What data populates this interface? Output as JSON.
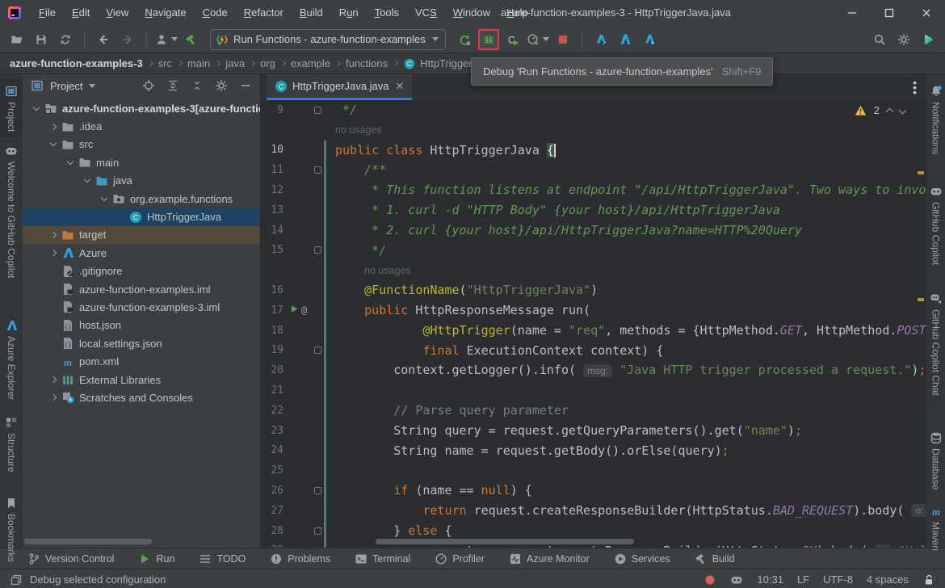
{
  "app": {
    "title": "azure-function-examples-3 - HttpTriggerJava.java"
  },
  "menu_bar": {
    "items": [
      {
        "label": "File",
        "m": 0
      },
      {
        "label": "Edit",
        "m": 0
      },
      {
        "label": "View",
        "m": 0
      },
      {
        "label": "Navigate",
        "m": 0
      },
      {
        "label": "Code",
        "m": 0
      },
      {
        "label": "Refactor",
        "m": 0
      },
      {
        "label": "Build",
        "m": 0
      },
      {
        "label": "Run",
        "m": 1
      },
      {
        "label": "Tools",
        "m": 0
      },
      {
        "label": "VCS",
        "m": 2
      },
      {
        "label": "Window",
        "m": 0
      },
      {
        "label": "Help",
        "m": 0
      }
    ]
  },
  "toolbar": {
    "run_config": {
      "label": "Run Functions - azure-function-examples",
      "icon": "azure-fn"
    },
    "buttons_left": [
      "open",
      "save",
      "sync",
      "back",
      "forward",
      "user",
      "hammer"
    ],
    "buttons_run": [
      "rerun",
      "debug",
      "coverage",
      "profiler",
      "stop"
    ],
    "buttons_azure": [
      "azure-action-1",
      "azure-action-2",
      "azure-action-3"
    ],
    "buttons_right": [
      "search",
      "settings",
      "plugin"
    ],
    "debug_highlighted": true
  },
  "tooltip": {
    "text": "Debug 'Run Functions - azure-function-examples'",
    "shortcut": "Shift+F9"
  },
  "breadcrumbs": {
    "items": [
      "azure-function-examples-3",
      "src",
      "main",
      "java",
      "org",
      "example",
      "functions",
      "HttpTriggerJava"
    ]
  },
  "left_stripe": {
    "items": [
      {
        "label": "Project",
        "icon": "project-tool",
        "active": true
      },
      {
        "label": "Welcome to GitHub Copilot",
        "icon": "copilot"
      },
      {
        "label": "Azure Explorer",
        "icon": "azure"
      },
      {
        "label": "Structure",
        "icon": "structure"
      },
      {
        "label": "Bookmarks",
        "icon": "bookmarks"
      }
    ]
  },
  "right_stripe": {
    "items": [
      {
        "label": "Notifications",
        "icon": "bell"
      },
      {
        "label": "GitHub Copilot",
        "icon": "copilot"
      },
      {
        "label": "GitHub Copilot Chat",
        "icon": "copilot-chat"
      },
      {
        "label": "Database",
        "icon": "database"
      },
      {
        "label": "Maven",
        "icon": "maven"
      }
    ]
  },
  "project_panel": {
    "title": "Project",
    "header_buttons": [
      "locate",
      "expand-all",
      "collapse-all",
      "options",
      "hide"
    ],
    "tree": [
      {
        "label": "azure-function-examples-3",
        "suffix": " [azure-functio",
        "level": 0,
        "chev": "open",
        "icon": "folder-root",
        "bold": true
      },
      {
        "label": ".idea",
        "level": 1,
        "chev": "closed",
        "icon": "folder"
      },
      {
        "label": "src",
        "level": 1,
        "chev": "open",
        "icon": "folder"
      },
      {
        "label": "main",
        "level": 2,
        "chev": "open",
        "icon": "folder"
      },
      {
        "label": "java",
        "level": 3,
        "chev": "open",
        "icon": "folder-src"
      },
      {
        "label": "org.example.functions",
        "level": 4,
        "chev": "open",
        "icon": "package"
      },
      {
        "label": "HttpTriggerJava",
        "level": 5,
        "chev": "none",
        "icon": "class",
        "selected": true
      },
      {
        "label": "target",
        "level": 1,
        "chev": "closed",
        "icon": "folder-excluded",
        "highlight": true
      },
      {
        "label": "Azure",
        "level": 1,
        "chev": "closed",
        "icon": "azure"
      },
      {
        "label": ".gitignore",
        "level": 1,
        "chev": "none",
        "icon": "file-ignore"
      },
      {
        "label": "azure-function-examples.iml",
        "level": 1,
        "chev": "none",
        "icon": "file-iml"
      },
      {
        "label": "azure-function-examples-3.iml",
        "level": 1,
        "chev": "none",
        "icon": "file-iml"
      },
      {
        "label": "host.json",
        "level": 1,
        "chev": "none",
        "icon": "file-json"
      },
      {
        "label": "local.settings.json",
        "level": 1,
        "chev": "none",
        "icon": "file-json"
      },
      {
        "label": "pom.xml",
        "level": 1,
        "chev": "none",
        "icon": "maven"
      },
      {
        "label": "External Libraries",
        "level": 1,
        "chev": "closed",
        "icon": "libraries"
      },
      {
        "label": "Scratches and Consoles",
        "level": 1,
        "chev": "closed",
        "icon": "scratches"
      }
    ]
  },
  "editor": {
    "tab": {
      "label": "HttpTriggerJava.java",
      "icon": "class"
    },
    "inspections": {
      "warning_count": "2"
    },
    "lines": [
      {
        "n": "9",
        "fold": true,
        "seg": [
          [
            " */",
            "doc"
          ]
        ]
      },
      {
        "usages": "no usages",
        "indent": 0
      },
      {
        "n": "10",
        "vcs": true,
        "cursor": true,
        "seg": [
          [
            "public ",
            "k"
          ],
          [
            "class ",
            "k"
          ],
          [
            "HttpTriggerJava ",
            "t"
          ],
          [
            "{",
            "brhl"
          ]
        ]
      },
      {
        "n": "11",
        "vcs": true,
        "fold": true,
        "seg": [
          [
            "    /**",
            "doc"
          ]
        ]
      },
      {
        "n": "12",
        "vcs": true,
        "seg": [
          [
            "     * This function listens at endpoint \"/api/HttpTriggerJava\". Two ways to invoke it using \"curl\" command in bash:",
            "doc"
          ]
        ]
      },
      {
        "n": "13",
        "vcs": true,
        "seg": [
          [
            "     * 1. curl -d \"HTTP Body\" {your host}/api/HttpTriggerJava",
            "doc"
          ]
        ]
      },
      {
        "n": "14",
        "vcs": true,
        "seg": [
          [
            "     * 2. curl {your host}/api/HttpTriggerJava?name=HTTP%20Query",
            "doc"
          ]
        ]
      },
      {
        "n": "15",
        "vcs": true,
        "fold": true,
        "seg": [
          [
            "     */",
            "doc"
          ]
        ]
      },
      {
        "usages": "no usages",
        "indent": 4,
        "vcs": true
      },
      {
        "n": "16",
        "vcs": true,
        "seg": [
          [
            "    ",
            "t"
          ],
          [
            "@FunctionName",
            "ann"
          ],
          [
            "(",
            "t"
          ],
          [
            "\"HttpTriggerJava\"",
            "s"
          ],
          [
            ")",
            "t"
          ]
        ]
      },
      {
        "n": "17",
        "vcs": true,
        "mark": "run",
        "seg": [
          [
            "    ",
            "t"
          ],
          [
            "public ",
            "k"
          ],
          [
            "HttpResponseMessage run(",
            "t"
          ]
        ]
      },
      {
        "n": "18",
        "vcs": true,
        "seg": [
          [
            "            ",
            "t"
          ],
          [
            "@HttpTrigger",
            "ann"
          ],
          [
            "(name = ",
            "t"
          ],
          [
            "\"req\"",
            "s"
          ],
          [
            ", methods = {HttpMethod.",
            "t"
          ],
          [
            "GET",
            "fld"
          ],
          [
            ", HttpMethod.",
            "t"
          ],
          [
            "POST",
            "fld"
          ]
        ]
      },
      {
        "n": "19",
        "vcs": true,
        "fold": true,
        "seg": [
          [
            "            ",
            "t"
          ],
          [
            "final ",
            "k"
          ],
          [
            "ExecutionContext context) {",
            "t"
          ]
        ]
      },
      {
        "n": "20",
        "vcs": true,
        "seg": [
          [
            "        context.getLogger().info( ",
            "t"
          ],
          [
            "msg:",
            "hint"
          ],
          [
            " ",
            "t"
          ],
          [
            "\"Java HTTP trigger processed a request.\"",
            "s"
          ],
          [
            ")",
            "t"
          ],
          [
            ";",
            "semi"
          ]
        ]
      },
      {
        "n": "21",
        "vcs": true,
        "seg": []
      },
      {
        "n": "22",
        "vcs": true,
        "seg": [
          [
            "        ",
            "t"
          ],
          [
            "// Parse query parameter",
            "com"
          ]
        ]
      },
      {
        "n": "23",
        "vcs": true,
        "seg": [
          [
            "        String query = request.getQueryParameters().get(",
            "t"
          ],
          [
            "\"name\"",
            "s"
          ],
          [
            ")",
            "t"
          ],
          [
            ";",
            "semi"
          ]
        ]
      },
      {
        "n": "24",
        "vcs": true,
        "seg": [
          [
            "        String name = request.getBody().orElse(query)",
            "t"
          ],
          [
            ";",
            "semi"
          ]
        ]
      },
      {
        "n": "25",
        "vcs": true,
        "seg": []
      },
      {
        "n": "26",
        "vcs": true,
        "fold": true,
        "seg": [
          [
            "        ",
            "t"
          ],
          [
            "if ",
            "k"
          ],
          [
            "(name == ",
            "t"
          ],
          [
            "null",
            "k"
          ],
          [
            ") {",
            "t"
          ]
        ]
      },
      {
        "n": "27",
        "vcs": true,
        "seg": [
          [
            "            ",
            "t"
          ],
          [
            "return ",
            "k"
          ],
          [
            "request.createResponseBuilder(HttpStatus.",
            "t"
          ],
          [
            "BAD_REQUEST",
            "fld"
          ],
          [
            ").body( ",
            "t"
          ],
          [
            "o:",
            "hint"
          ]
        ]
      },
      {
        "n": "28",
        "vcs": true,
        "fold": true,
        "seg": [
          [
            "        } ",
            "t"
          ],
          [
            "else ",
            "k"
          ],
          [
            "{",
            "t"
          ]
        ]
      },
      {
        "n": "29",
        "vcs": true,
        "partial": true,
        "seg": [
          [
            "                return request.createResponseBuilder(HttpStatus.",
            "t"
          ],
          [
            "OK",
            "fld"
          ],
          [
            ").body( ",
            "t"
          ],
          [
            "o:",
            "hint"
          ],
          [
            " ",
            "t"
          ],
          [
            "\"Hello, \"",
            "s"
          ],
          [
            " + name).build()",
            "t"
          ],
          [
            ";",
            "semi"
          ]
        ]
      }
    ]
  },
  "bottom_bar": {
    "items": [
      {
        "label": "Version Control",
        "icon": "branch"
      },
      {
        "label": "Run",
        "icon": "play"
      },
      {
        "label": "TODO",
        "icon": "todo"
      },
      {
        "label": "Problems",
        "icon": "problems"
      },
      {
        "label": "Terminal",
        "icon": "terminal"
      },
      {
        "label": "Profiler",
        "icon": "profiler"
      },
      {
        "label": "Azure Monitor",
        "icon": "monitor"
      },
      {
        "label": "Services",
        "icon": "services"
      },
      {
        "label": "Build",
        "icon": "hammer-grey"
      }
    ]
  },
  "status_bar": {
    "message": "Debug selected configuration",
    "position": "10:31",
    "line_separator": "LF",
    "encoding": "UTF-8",
    "indent": "4 spaces"
  },
  "colors": {
    "accent": "#3574f0",
    "selection": "#1d4263",
    "warning": "#f2bb4c",
    "vcs_added": "#4f7e68",
    "debug_highlight": "#e23b3b"
  }
}
